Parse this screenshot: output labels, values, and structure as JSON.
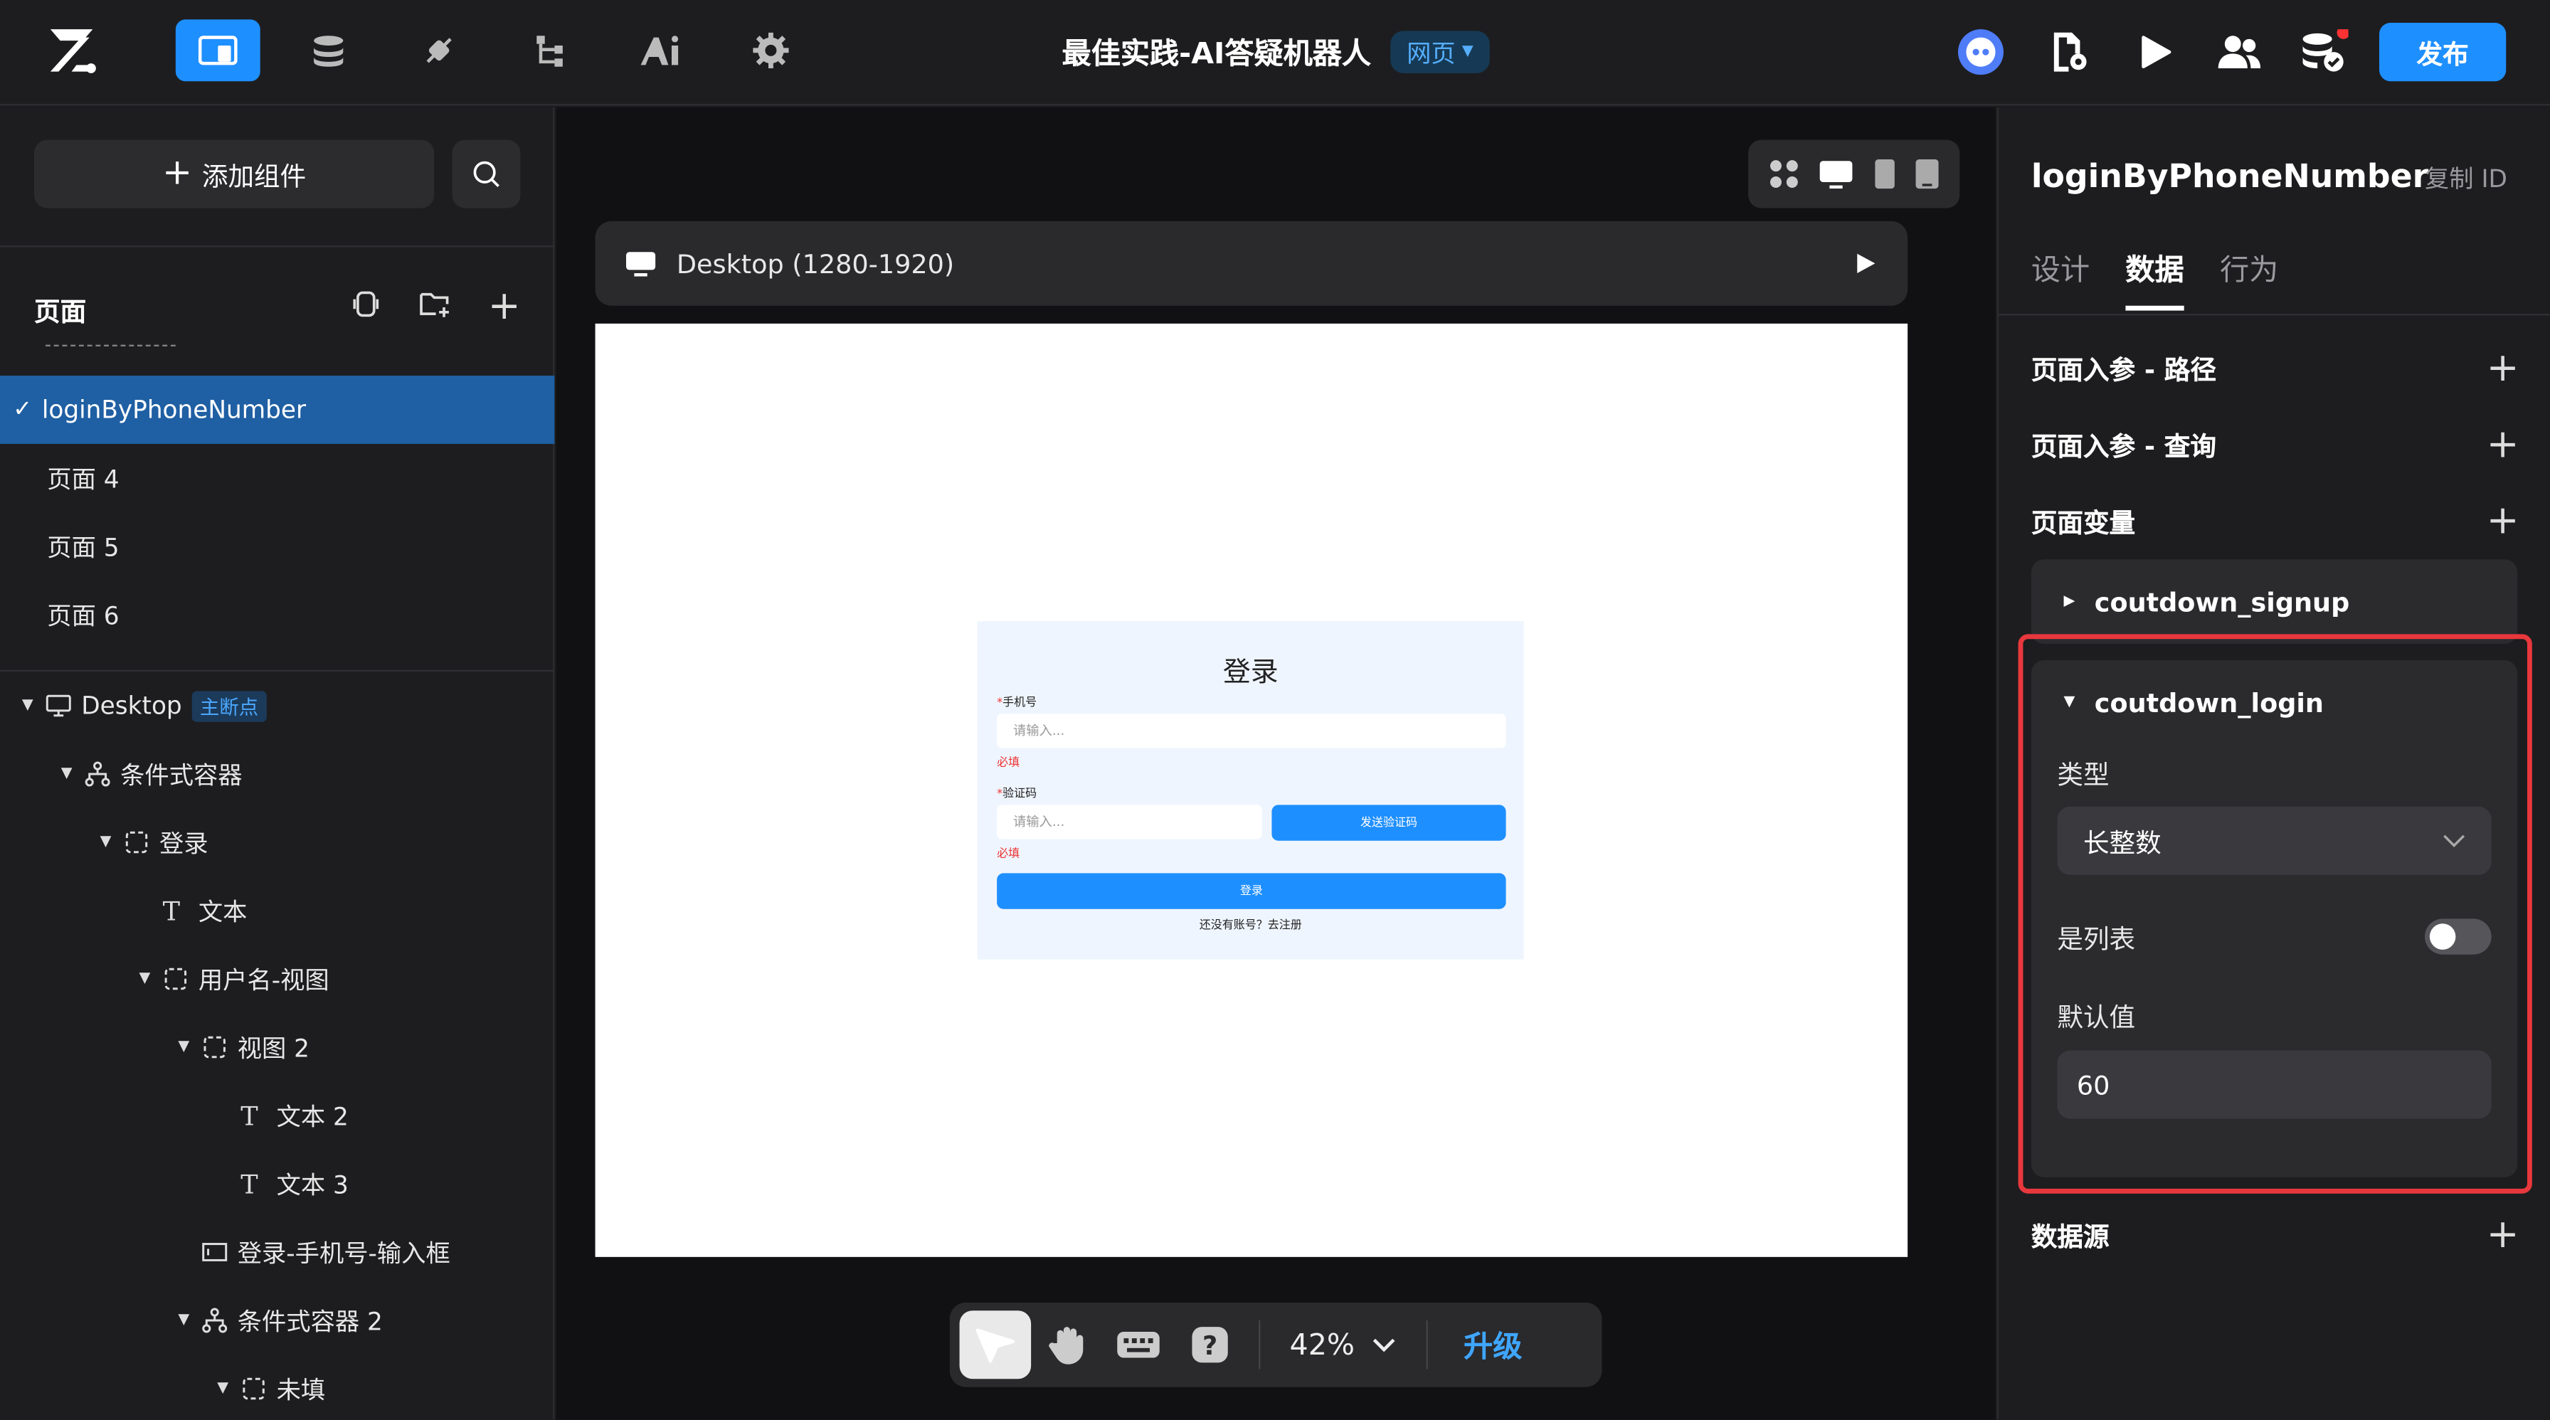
{
  "header": {
    "title": "最佳实践-AI答疑机器人",
    "platform_badge": "网页",
    "publish_label": "发布",
    "nav_icons": [
      "layout-icon",
      "database-icon",
      "plugin-icon",
      "flow-icon",
      "ai-icon",
      "settings-icon"
    ],
    "right_icons": [
      "bot-avatar-icon",
      "document-settings-icon",
      "play-icon",
      "users-icon",
      "database-check-icon"
    ]
  },
  "left": {
    "add_component": "添加组件",
    "pages_title": "页面",
    "pages": [
      {
        "label": "loginByPhoneNumber",
        "selected": true
      },
      {
        "label": "页面 4"
      },
      {
        "label": "页面 5"
      },
      {
        "label": "页面 6"
      }
    ],
    "tree": [
      {
        "label": "Desktop",
        "badge": "主断点",
        "icon": "monitor-icon"
      },
      {
        "label": "条件式容器",
        "icon": "branch-icon"
      },
      {
        "label": "登录",
        "icon": "dashed-box-icon"
      },
      {
        "label": "文本",
        "icon": "text-icon"
      },
      {
        "label": "用户名-视图",
        "icon": "dashed-box-icon"
      },
      {
        "label": "视图 2",
        "icon": "dashed-box-icon"
      },
      {
        "label": "文本 2",
        "icon": "text-icon"
      },
      {
        "label": "文本 3",
        "icon": "text-icon"
      },
      {
        "label": "登录-手机号-输入框",
        "icon": "input-icon"
      },
      {
        "label": "条件式容器 2",
        "icon": "branch-icon"
      },
      {
        "label": "未填",
        "icon": "dashed-box-icon"
      }
    ]
  },
  "center": {
    "device_label": "Desktop (1280-1920)",
    "form": {
      "title": "登录",
      "phone_label": "手机号",
      "phone_placeholder": "请输入...",
      "required_text": "必填",
      "code_label": "验证码",
      "code_placeholder": "请输入...",
      "send_code_label": "发送验证码",
      "login_label": "登录",
      "register_text": "还没有账号？去注册",
      "required_mark": "*"
    },
    "zoom": "42%",
    "upgrade": "升级"
  },
  "right": {
    "title": "loginByPhoneNumber",
    "copy_id": "复制 ID",
    "tabs": [
      "设计",
      "数据",
      "行为"
    ],
    "selected_tab": "数据",
    "sections": {
      "path_params": "页面入参 - 路径",
      "query_params": "页面入参 - 查询",
      "page_vars": "页面变量",
      "datasource": "数据源"
    },
    "vars": [
      {
        "name": "coutdown_signup",
        "expanded": false
      },
      {
        "name": "coutdown_login",
        "expanded": true
      }
    ],
    "var_detail": {
      "type_label": "类型",
      "type_value": "长整数",
      "is_list_label": "是列表",
      "is_list": false,
      "default_label": "默认值",
      "default_value": "60"
    }
  },
  "colors": {
    "accent": "#1e8fff",
    "highlight_border": "#e8383d",
    "selected_row": "#1f5fa3"
  }
}
